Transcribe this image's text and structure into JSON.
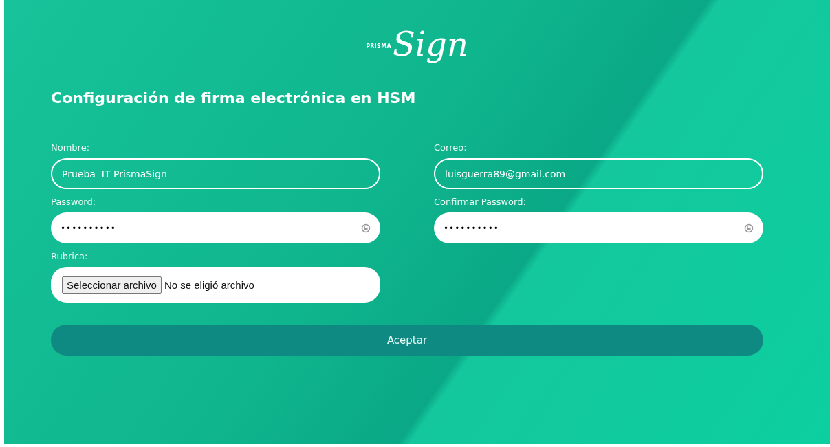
{
  "logo": {
    "prefix": "PRISMA",
    "script": "Sign"
  },
  "title": "Configuración de firma electrónica en HSM",
  "fields": [
    {
      "label": "Nombre:",
      "kind": "text",
      "value": "Prueba  IT PrismaSign"
    },
    {
      "label": "Correo:",
      "kind": "text",
      "value": "luisguerra89@gmail.com"
    },
    {
      "label": "Password:",
      "kind": "password",
      "value": "••••••••••"
    },
    {
      "label": "Confirmar Password:",
      "kind": "password",
      "value": "••••••••••"
    },
    {
      "label": "Rubrica:",
      "kind": "file",
      "button": "Seleccionar archivo",
      "status": "No se eligió archivo"
    }
  ],
  "submit": "Aceptar"
}
